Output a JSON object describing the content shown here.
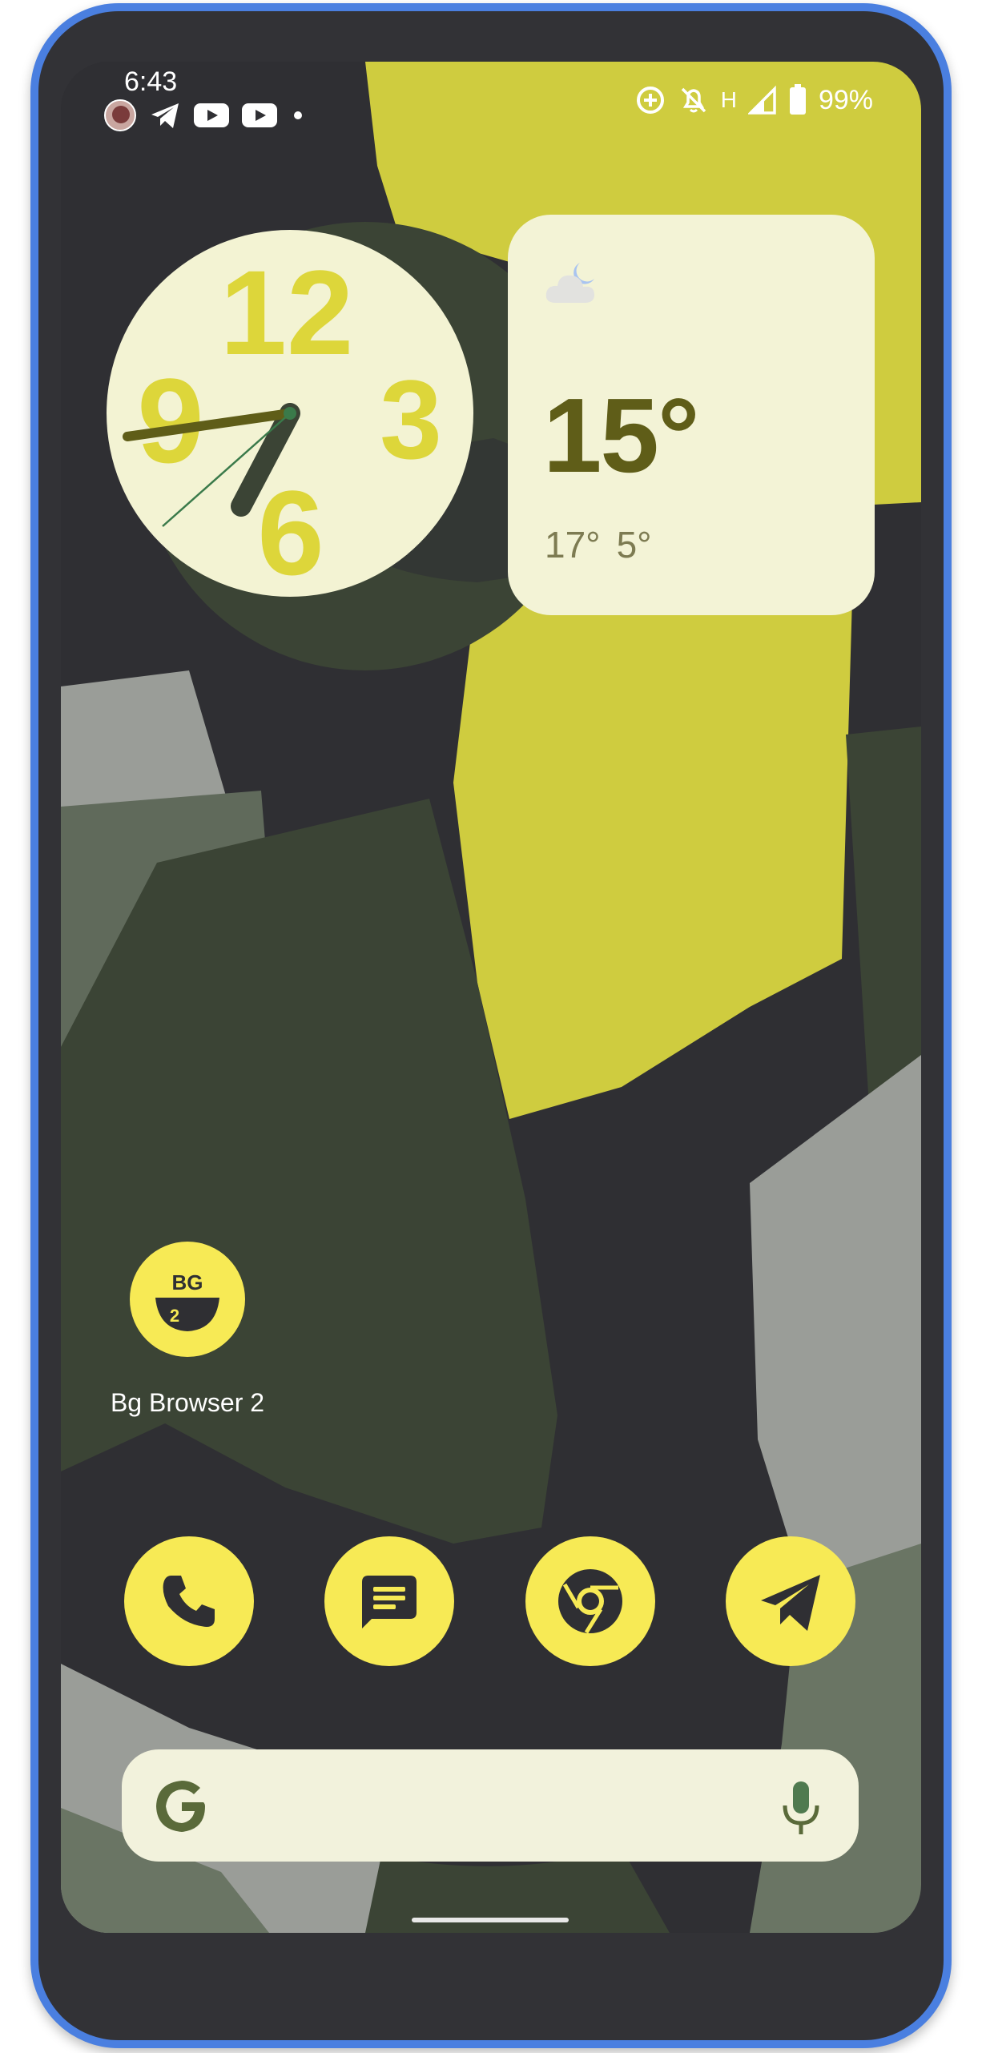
{
  "status_bar": {
    "time": "6:43",
    "network": "H",
    "battery": "99%",
    "left_icons": [
      "avatar-icon",
      "telegram-icon",
      "youtube-icon",
      "youtube-icon",
      "dot-icon"
    ],
    "right_icons": [
      "data-saver-icon",
      "notifications-off-icon",
      "signal-icon",
      "battery-icon"
    ]
  },
  "clock": {
    "numerals": [
      "12",
      "3",
      "6",
      "9"
    ],
    "time_shown": "6:43"
  },
  "weather": {
    "condition_icon": "cloudy-night-icon",
    "temperature": "15°",
    "high": "17°",
    "low": "5°"
  },
  "home": {
    "app": {
      "label": "Bg Browser 2",
      "icon_text": "BG",
      "badge": "2"
    }
  },
  "dock": {
    "apps": [
      "phone",
      "messages",
      "chrome",
      "telegram"
    ]
  },
  "search": {
    "logo": "G",
    "mic_icon": "mic-icon"
  },
  "colors": {
    "frame": "#4a7fe0",
    "accent_yellow": "#f7ea55",
    "clock_face": "#f3f3d3",
    "clock_numerals": "#ddd63a",
    "dark_olive": "#3b4435",
    "weather_text": "#5f5d18"
  }
}
